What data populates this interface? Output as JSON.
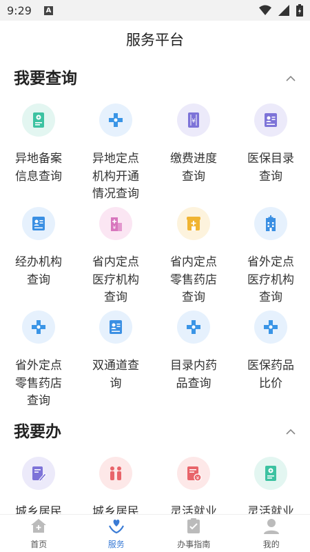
{
  "status": {
    "time": "9:29",
    "notif": "A"
  },
  "header": {
    "title": "服务平台"
  },
  "query_section": {
    "title": "我要查询",
    "items": [
      {
        "label": "异地备案信息查询",
        "icon": "document-badge-icon",
        "bg": "#e3f6f1",
        "fg": "#3cc2a1"
      },
      {
        "label": "异地定点机构开通情况查询",
        "icon": "medical-cross-icon",
        "bg": "#e6f1fd",
        "fg": "#3a95e6"
      },
      {
        "label": "缴费进度查询",
        "icon": "yuan-receipt-icon",
        "bg": "#eceafa",
        "fg": "#7d73d8"
      },
      {
        "label": "医保目录查询",
        "icon": "id-card-icon",
        "bg": "#eceafa",
        "fg": "#7d73d8"
      },
      {
        "label": "经办机构查询",
        "icon": "profile-card-icon",
        "bg": "#e6f1fd",
        "fg": "#3a8fe3"
      },
      {
        "label": "省内定点医疗机构查询",
        "icon": "hospital-building-icon",
        "bg": "#fbe6f3",
        "fg": "#d876bd"
      },
      {
        "label": "省内定点零售药店查询",
        "icon": "pharmacy-store-icon",
        "bg": "#fdf3dd",
        "fg": "#f0b432"
      },
      {
        "label": "省外定点医疗机构查询",
        "icon": "hospital-icon",
        "bg": "#e6f1fd",
        "fg": "#3a8fe3"
      },
      {
        "label": "省外定点零售药店查询",
        "icon": "medical-cross-icon",
        "bg": "#e6f1fd",
        "fg": "#3a95e6"
      },
      {
        "label": "双通道查询",
        "icon": "profile-card-icon",
        "bg": "#e6f1fd",
        "fg": "#3a8fe3"
      },
      {
        "label": "目录内药品查询",
        "icon": "medical-cross-icon",
        "bg": "#e6f1fd",
        "fg": "#3a95e6"
      },
      {
        "label": "医保药品比价",
        "icon": "medical-cross-icon",
        "bg": "#e6f1fd",
        "fg": "#3a95e6"
      }
    ]
  },
  "do_section": {
    "title": "我要办",
    "items": [
      {
        "label": "城乡居民",
        "icon": "edit-document-icon",
        "bg": "#eceafa",
        "fg": "#7d73d8"
      },
      {
        "label": "城乡居民",
        "icon": "family-icon",
        "bg": "#fde8e8",
        "fg": "#e8646a"
      },
      {
        "label": "灵活就业",
        "icon": "yuan-document-icon",
        "bg": "#fde8e8",
        "fg": "#e8646a"
      },
      {
        "label": "灵活就业",
        "icon": "document-badge-icon",
        "bg": "#e3f6f1",
        "fg": "#3cc2a1"
      }
    ]
  },
  "tabbar": {
    "tabs": [
      {
        "label": "首页",
        "icon": "home-icon",
        "active": false
      },
      {
        "label": "服务",
        "icon": "heart-hands-icon",
        "active": true
      },
      {
        "label": "办事指南",
        "icon": "checklist-icon",
        "active": false
      },
      {
        "label": "我的",
        "icon": "user-icon",
        "active": false
      }
    ]
  },
  "colors": {
    "accent": "#3a7bd5",
    "inactive": "#bbbbbb"
  }
}
